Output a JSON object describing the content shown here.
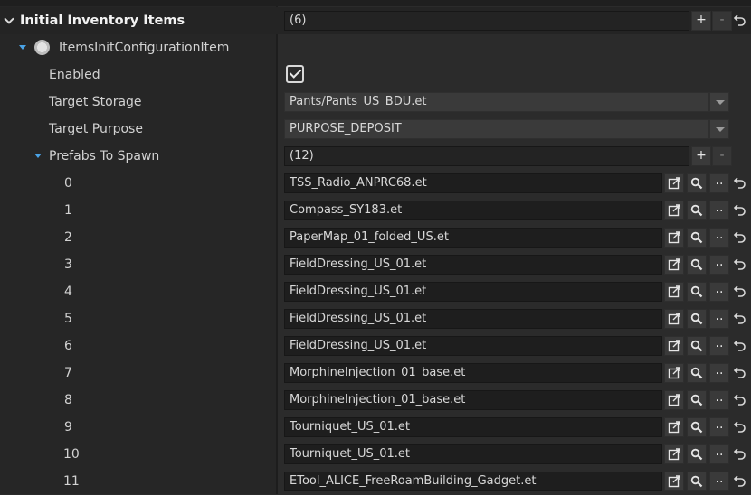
{
  "root": {
    "label": "Initial Inventory Items",
    "count": "(6)"
  },
  "item": {
    "label": "ItemsInitConfigurationItem"
  },
  "props": {
    "enabled_label": "Enabled",
    "target_storage_label": "Target Storage",
    "target_storage_value": "Pants/Pants_US_BDU.et",
    "target_purpose_label": "Target Purpose",
    "target_purpose_value": "PURPOSE_DEPOSIT",
    "enabled_checked": true
  },
  "prefabs": {
    "label": "Prefabs To Spawn",
    "count": "(12)",
    "items": [
      {
        "index": "0",
        "value": "TSS_Radio_ANPRC68.et"
      },
      {
        "index": "1",
        "value": "Compass_SY183.et"
      },
      {
        "index": "2",
        "value": "PaperMap_01_folded_US.et"
      },
      {
        "index": "3",
        "value": "FieldDressing_US_01.et"
      },
      {
        "index": "4",
        "value": "FieldDressing_US_01.et"
      },
      {
        "index": "5",
        "value": "FieldDressing_US_01.et"
      },
      {
        "index": "6",
        "value": "FieldDressing_US_01.et"
      },
      {
        "index": "7",
        "value": "MorphineInjection_01_base.et"
      },
      {
        "index": "8",
        "value": "MorphineInjection_01_base.et"
      },
      {
        "index": "9",
        "value": "Tourniquet_US_01.et"
      },
      {
        "index": "10",
        "value": "Tourniquet_US_01.et"
      },
      {
        "index": "11",
        "value": "ETool_ALICE_FreeRoamBuilding_Gadget.et"
      }
    ]
  },
  "buttons": {
    "add": "+",
    "remove": "-",
    "browse": ".."
  },
  "icons": {
    "expand": "chevron-down-icon",
    "open": "open-external-icon",
    "search": "search-icon",
    "reset": "undo-icon",
    "config": "gear-icon"
  },
  "colors": {
    "accent": "#4aa3e6",
    "background": "#2b2b2b",
    "field": "#1e1e1e"
  }
}
